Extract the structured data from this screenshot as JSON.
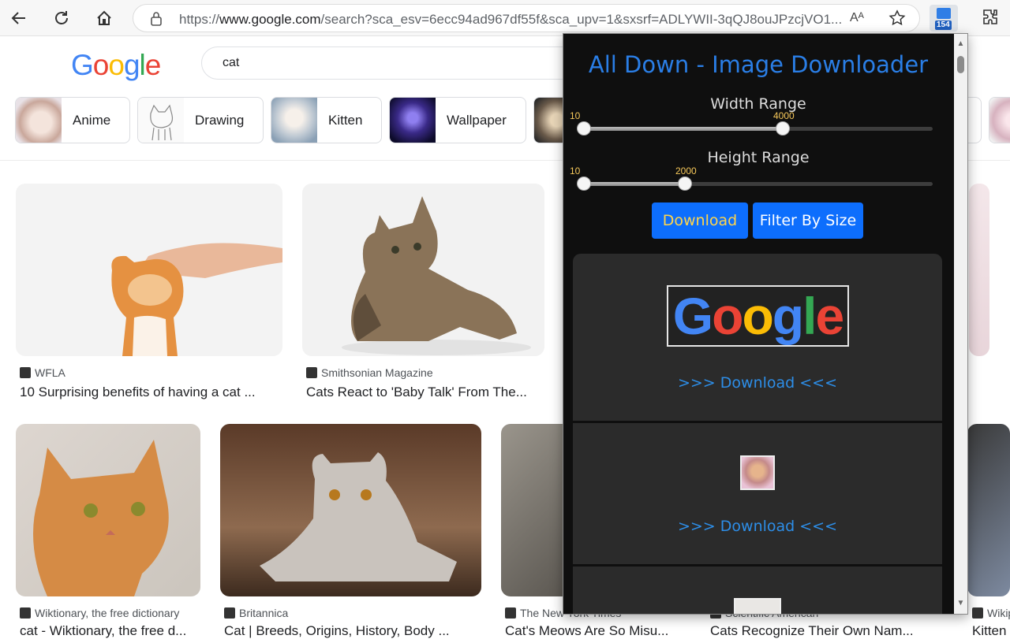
{
  "browser": {
    "url_prefix": "https://",
    "url_host": "www.google.com",
    "url_rest": "/search?sca_esv=6ecc94ad967df55f&sca_upv=1&sxsrf=ADLYWII-3qQJ8ouJPzcjVO1...",
    "read_aloud_label": "Aᴬ",
    "extension_badge": "154"
  },
  "google": {
    "logo_letters": [
      "G",
      "o",
      "o",
      "g",
      "l",
      "e"
    ],
    "logo_colors": [
      "#4285F4",
      "#EA4335",
      "#FBBC05",
      "#4285F4",
      "#34A853",
      "#EA4335"
    ],
    "search_value": "cat",
    "chips": [
      "Anime",
      "Drawing",
      "Kitten",
      "Wallpaper"
    ],
    "results": [
      {
        "source": "WFLA",
        "title": "10 Surprising benefits of having a cat ..."
      },
      {
        "source": "Smithsonian Magazine",
        "title": "Cats React to 'Baby Talk' From The..."
      },
      {
        "source": "Wiktionary, the free dictionary",
        "title": "cat - Wiktionary, the free d..."
      },
      {
        "source": "Britannica",
        "title": "Cat | Breeds, Origins, History, Body ..."
      },
      {
        "source": "The New York Times",
        "title": "Cat's Meows Are So Misu..."
      },
      {
        "source": "Scientific American",
        "title": "Cats Recognize Their Own Nam..."
      },
      {
        "source": "Wikiped",
        "title": "Kitten - W..."
      }
    ]
  },
  "extension": {
    "title": "All Down - Image Downloader",
    "width_label": "Width Range",
    "width_min": "10",
    "width_max": "4000",
    "width_fill_fraction": 0.57,
    "height_label": "Height Range",
    "height_min": "10",
    "height_max": "2000",
    "height_fill_fraction": 0.29,
    "download_button": "Download",
    "filter_button": "Filter By Size",
    "item_link": ">>> Download <<<",
    "accent": "#0d6efd",
    "title_color": "#2a7ee6",
    "download_btn_text_color": "#ffd54a"
  }
}
